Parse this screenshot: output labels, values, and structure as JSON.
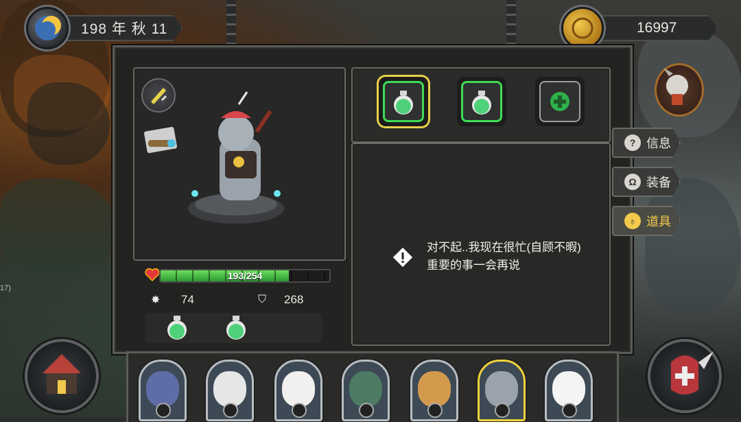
{
  "top_hud": {
    "date_text": "198 年 秋 11",
    "gold_amount": "16997"
  },
  "unit": {
    "hp_current": 193,
    "hp_max": 254,
    "hp_text": "193/254",
    "attack": "74",
    "defense": "268",
    "consumables": [
      "green-potion",
      "green-potion"
    ]
  },
  "item_slots": [
    {
      "icon": "green-potion",
      "state": "selected"
    },
    {
      "icon": "green-potion",
      "state": "filled"
    },
    {
      "icon": "plus",
      "state": "empty"
    }
  ],
  "message": {
    "text": "对不起..我现在很忙(自顾不暇)重要的事一会再说"
  },
  "side_tabs": [
    {
      "label": "信息",
      "icon": "info-icon",
      "active": false
    },
    {
      "label": "装备",
      "icon": "helmet-icon",
      "active": false
    },
    {
      "label": "道具",
      "icon": "bag-icon",
      "active": true
    }
  ],
  "roster": [
    {
      "animal": "bear",
      "color": "#5e6da8"
    },
    {
      "animal": "eagle",
      "color": "#e6e6e6"
    },
    {
      "animal": "sheep",
      "color": "#f2f0ee"
    },
    {
      "animal": "crocodile",
      "color": "#4d7a63"
    },
    {
      "animal": "giraffe",
      "color": "#d39a4e"
    },
    {
      "animal": "elephant",
      "color": "#9aa3ab",
      "selected": true
    },
    {
      "animal": "polar-bear",
      "color": "#f4f4f4"
    }
  ],
  "colors": {
    "hp_green": "#2c9a34",
    "selected_gold": "#f0d33a",
    "potion_green": "#4fd17a"
  },
  "side_label_left": "17)"
}
